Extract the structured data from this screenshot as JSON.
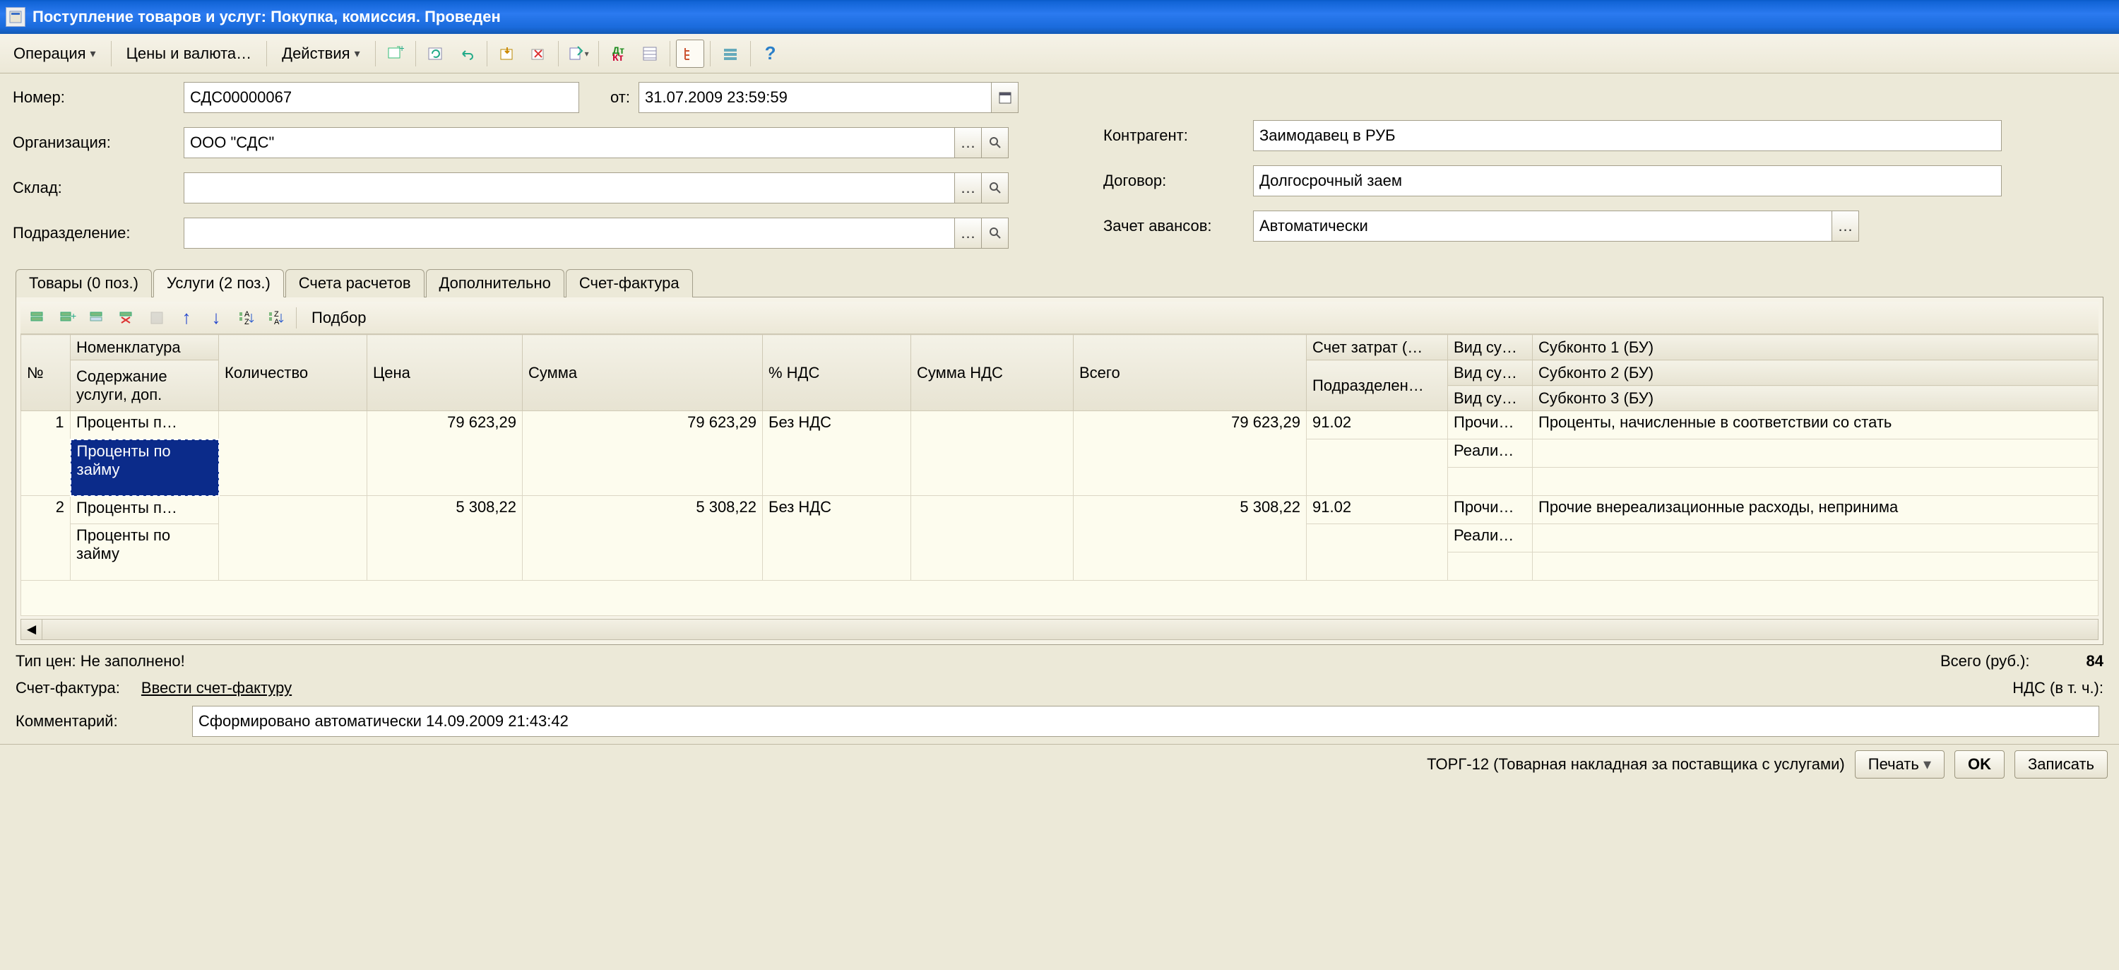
{
  "window": {
    "title": "Поступление товаров и услуг: Покупка, комиссия. Проведен"
  },
  "menu": {
    "operation": "Операция",
    "pricesCurrency": "Цены и валюта…",
    "actions": "Действия"
  },
  "form": {
    "labels": {
      "number": "Номер:",
      "from": "от:",
      "organization": "Организация:",
      "warehouse": "Склад:",
      "subdivision": "Подразделение:",
      "contragent": "Контрагент:",
      "contract": "Договор:",
      "advances": "Зачет авансов:"
    },
    "values": {
      "number": "СДС00000067",
      "date": "31.07.2009 23:59:59",
      "organization": "ООО \"СДС\"",
      "warehouse": "",
      "subdivision": "",
      "contragent": "Заимодавец в РУБ",
      "contract": "Долгосрочный заем",
      "advances": "Автоматически"
    }
  },
  "tabs": {
    "goods": "Товары (0 поз.)",
    "services": "Услуги (2 поз.)",
    "accounts": "Счета расчетов",
    "additional": "Дополнительно",
    "invoice": "Счет-фактура"
  },
  "rowToolbar": {
    "selection": "Подбор"
  },
  "grid": {
    "headers": {
      "n": "№",
      "nomenclature": "Номенклатура",
      "serviceContent": "Содержание услуги, доп.",
      "qty": "Количество",
      "price": "Цена",
      "sum": "Сумма",
      "vatPct": "% НДС",
      "vatSum": "Сумма НДС",
      "total": "Всего",
      "costAccount": "Счет затрат (…",
      "subdivision": "Подразделен…",
      "kind": "Вид су…",
      "sub1": "Субконто 1 (БУ)",
      "sub2": "Субконто 2 (БУ)",
      "sub3": "Субконто 3 (БУ)"
    },
    "rows": [
      {
        "n": "1",
        "nomenclature": "Проценты п…",
        "serviceContent": "Проценты по займу",
        "price": "79 623,29",
        "sum": "79 623,29",
        "vatPct": "Без НДС",
        "total": "79 623,29",
        "costAccount": "91.02",
        "kind1": "Прочи…",
        "kind2": "Реали…",
        "sub1": "Проценты, начисленные в соответствии со стать"
      },
      {
        "n": "2",
        "nomenclature": "Проценты п…",
        "serviceContent": "Проценты по займу",
        "price": "5 308,22",
        "sum": "5 308,22",
        "vatPct": "Без НДС",
        "total": "5 308,22",
        "costAccount": "91.02",
        "kind1": "Прочи…",
        "kind2": "Реали…",
        "sub1": "Прочие внереализационные расходы, непринима"
      }
    ]
  },
  "footer": {
    "priceType": "Тип цен: Не заполнено!",
    "invoiceLabel": "Счет-фактура:",
    "invoiceLink": "Ввести счет-фактуру",
    "commentLabel": "Комментарий:",
    "comment": "Сформировано автоматически 14.09.2009 21:43:42",
    "totalsLabel": "Всего (руб.):",
    "totalsValue": "84",
    "vatLabel": "НДС (в т. ч.):"
  },
  "bottomBar": {
    "docInfo": "ТОРГ-12 (Товарная накладная за поставщика с услугами)",
    "print": "Печать",
    "ok": "OK",
    "save": "Записать"
  }
}
